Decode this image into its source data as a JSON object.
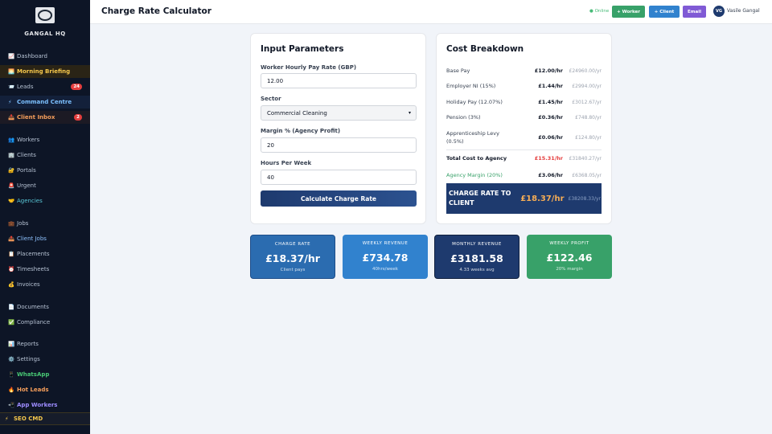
{
  "sidebar": {
    "brand": "GANGAL HQ",
    "logo_text": "GANGAL",
    "items": [
      {
        "icon": "📈",
        "label": "Dashboard"
      },
      {
        "icon": "🌅",
        "label": "Morning Briefing"
      },
      {
        "icon": "📨",
        "label": "Leads",
        "badge": "24"
      },
      {
        "icon": "⚡",
        "label": "Command Centre"
      },
      {
        "icon": "📥",
        "label": "Client Inbox",
        "badge": "2"
      },
      {
        "icon": "👥",
        "label": "Workers"
      },
      {
        "icon": "🏢",
        "label": "Clients"
      },
      {
        "icon": "🔐",
        "label": "Portals"
      },
      {
        "icon": "🚨",
        "label": "Urgent"
      },
      {
        "icon": "🤝",
        "label": "Agencies"
      },
      {
        "icon": "💼",
        "label": "Jobs"
      },
      {
        "icon": "📤",
        "label": "Client Jobs"
      },
      {
        "icon": "📋",
        "label": "Placements"
      },
      {
        "icon": "⏰",
        "label": "Timesheets"
      },
      {
        "icon": "💰",
        "label": "Invoices"
      },
      {
        "icon": "📄",
        "label": "Documents"
      },
      {
        "icon": "✅",
        "label": "Compliance"
      },
      {
        "icon": "📊",
        "label": "Reports"
      },
      {
        "icon": "⚙️",
        "label": "Settings"
      },
      {
        "icon": "📱",
        "label": "WhatsApp"
      },
      {
        "icon": "🔥",
        "label": "Hot Leads"
      },
      {
        "icon": "📲",
        "label": "App Workers"
      },
      {
        "icon": "⚡",
        "label": "SEO CMD"
      }
    ]
  },
  "topbar": {
    "title": "Charge Rate Calculator",
    "status": "Online",
    "btn_worker": "+ Worker",
    "btn_client": "+ Client",
    "btn_email": "Email",
    "avatar_initials": "VG",
    "user_name": "Vasile Gangal"
  },
  "input_params": {
    "heading": "Input Parameters",
    "pay_label": "Worker Hourly Pay Rate (GBP)",
    "pay_value": "12.00",
    "sector_label": "Sector",
    "sector_value": "Commercial Cleaning",
    "margin_label": "Margin % (Agency Profit)",
    "margin_value": "20",
    "hours_label": "Hours Per Week",
    "hours_value": "40",
    "calc_button": "Calculate Charge Rate"
  },
  "breakdown": {
    "heading": "Cost Breakdown",
    "rows": [
      {
        "label": "Base Pay",
        "rate": "£12.00/hr",
        "yearly": "£24960.00/yr"
      },
      {
        "label": "Employer NI (15%)",
        "rate": "£1.44/hr",
        "yearly": "£2994.00/yr"
      },
      {
        "label": "Holiday Pay (12.07%)",
        "rate": "£1.45/hr",
        "yearly": "£3012.67/yr"
      },
      {
        "label": "Pension (3%)",
        "rate": "£0.36/hr",
        "yearly": "£748.80/yr"
      },
      {
        "label": "Apprenticeship Levy (0.5%)",
        "rate": "£0.06/hr",
        "yearly": "£124.80/yr"
      },
      {
        "label": "Total Cost to Agency",
        "rate": "£15.31/hr",
        "yearly": "£31840.27/yr"
      },
      {
        "label": "Agency Margin (20%)",
        "rate": "£3.06/hr",
        "yearly": "£6368.05/yr"
      }
    ],
    "total_label": "CHARGE RATE TO CLIENT",
    "total_rate": "£18.37/hr",
    "total_yearly": "£38208.33/yr"
  },
  "stats": [
    {
      "label": "CHARGE RATE",
      "value": "£18.37/hr",
      "sub": "Client pays"
    },
    {
      "label": "WEEKLY REVENUE",
      "value": "£734.78",
      "sub": "40hrs/week"
    },
    {
      "label": "MONTHLY REVENUE",
      "value": "£3181.58",
      "sub": "4.33 weeks avg"
    },
    {
      "label": "WEEKLY PROFIT",
      "value": "£122.46",
      "sub": "20% margin"
    }
  ],
  "colors": {
    "sidebar_bg": "#0d1526",
    "navy": "#1e3a6e",
    "blue": "#2b6cb0",
    "bright_blue": "#3182ce",
    "green": "#38a169",
    "orange": "#f6ad55",
    "red": "#e53e3e",
    "purple": "#805ad5"
  }
}
